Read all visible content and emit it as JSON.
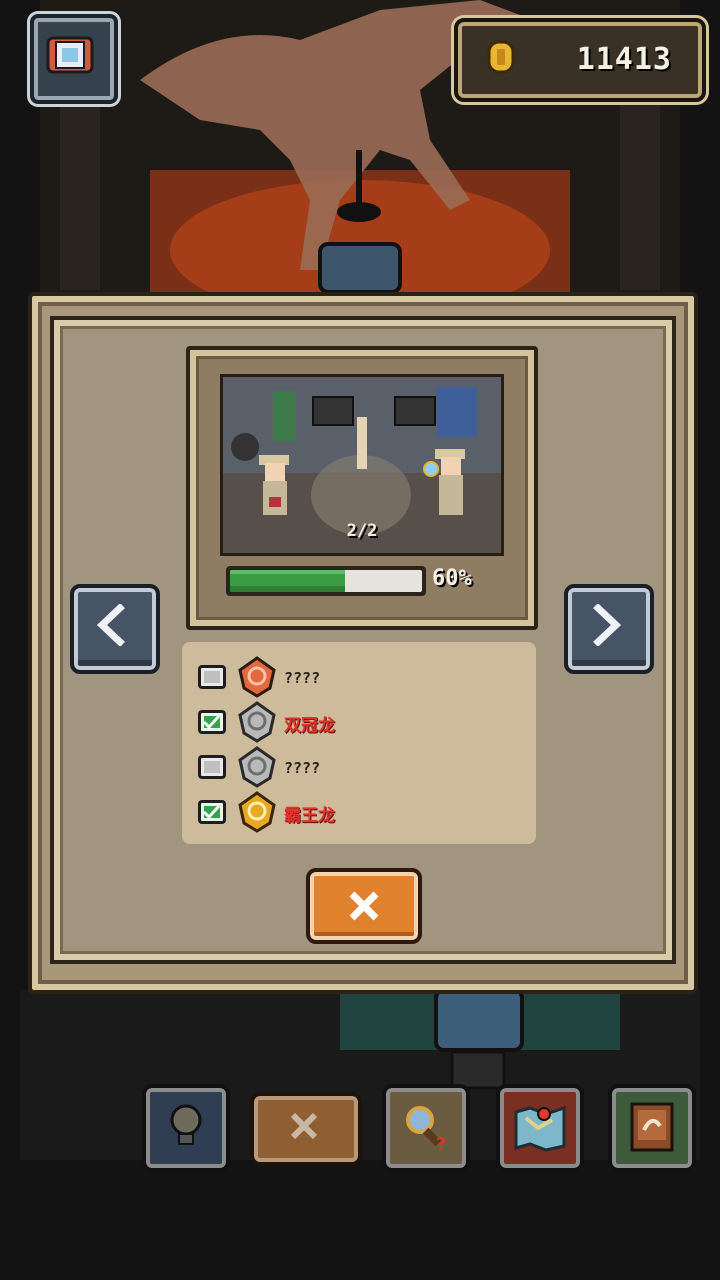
{
  "header": {
    "coins": "11413",
    "camera_icon": "camera-icon",
    "coin_icon": "coin-icon"
  },
  "modal": {
    "preview": {
      "page_counter": "2/2"
    },
    "progress": {
      "value": 0.6,
      "text": "60%"
    },
    "checklist": [
      {
        "checked": false,
        "label": "????",
        "badge": "red-fossil-badge",
        "badge_color": "#e4683e"
      },
      {
        "checked": true,
        "label": "双冠龙",
        "badge": "silver-fossil-badge",
        "badge_color": "#b9b9b9"
      },
      {
        "checked": false,
        "label": "????",
        "badge": "silver-fossil-badge",
        "badge_color": "#b9b9b9"
      },
      {
        "checked": true,
        "label": "霸王龙",
        "badge": "gold-fossil-badge",
        "badge_color": "#e7a823"
      }
    ],
    "prev_icon": "chevron-left-icon",
    "next_icon": "chevron-right-icon",
    "close_icon": "close-icon"
  },
  "toolbar": {
    "items": [
      "lightbulb-icon",
      "close-icon",
      "magnifier-question-icon",
      "map-icon",
      "book-icon"
    ]
  },
  "colors": {
    "accent_orange": "#e0812e",
    "progress_green": "#3d9a45",
    "known_label_red": "#e4332a"
  }
}
